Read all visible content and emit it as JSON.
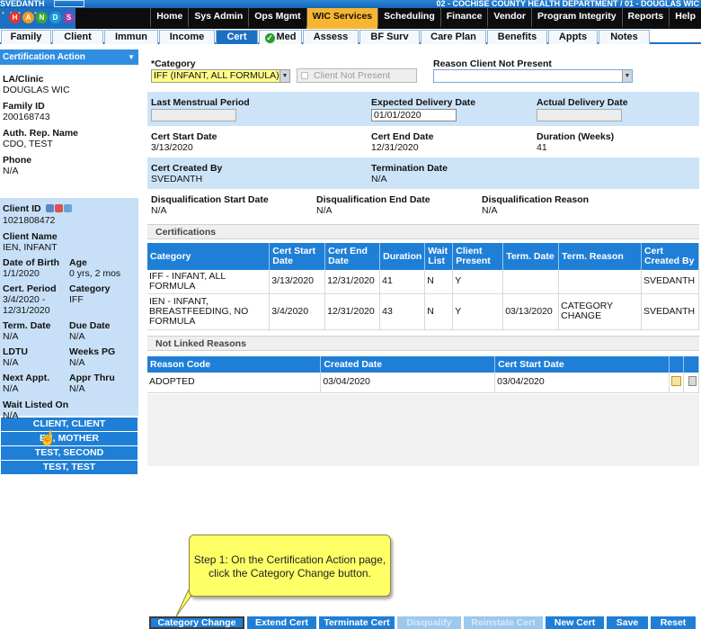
{
  "topbar": {
    "user": "SVEDANTH",
    "department": "02 - COCHISE COUNTY HEALTH DEPARTMENT / 01 - DOUGLAS WIC"
  },
  "logo": {
    "letters": [
      "H",
      "A",
      "N",
      "D",
      "S"
    ]
  },
  "main_nav": [
    {
      "label": "Home",
      "active": false
    },
    {
      "label": "Sys Admin",
      "active": false
    },
    {
      "label": "Ops Mgmt",
      "active": false
    },
    {
      "label": "WIC Services",
      "active": true
    },
    {
      "label": "Scheduling",
      "active": false
    },
    {
      "label": "Finance",
      "active": false
    },
    {
      "label": "Vendor",
      "active": false
    },
    {
      "label": "Program Integrity",
      "active": false
    },
    {
      "label": "Reports",
      "active": false
    },
    {
      "label": "Help",
      "active": false
    }
  ],
  "sub_tabs": [
    "Family",
    "Client",
    "Immun",
    "Income",
    "Cert",
    "Med",
    "Assess",
    "BF Surv",
    "Care Plan",
    "Benefits",
    "Appts",
    "Notes"
  ],
  "sub_tab_active": "Cert",
  "sidebar": {
    "header": "Certification Action",
    "la_clinic_label": "LA/Clinic",
    "la_clinic": "DOUGLAS WIC",
    "family_id_label": "Family ID",
    "family_id": "200168743",
    "auth_rep_label": "Auth. Rep. Name",
    "auth_rep": "CDO, TEST",
    "phone_label": "Phone",
    "phone": "N/A",
    "client_id_label": "Client ID",
    "client_id": "1021808472",
    "client_name_label": "Client Name",
    "client_name": "IEN, INFANT",
    "dob_label": "Date of Birth",
    "dob": "1/1/2020",
    "age_label": "Age",
    "age": "0 yrs, 2 mos",
    "cert_period_label": "Cert. Period",
    "cert_period_start": "3/4/2020 -",
    "cert_period_end": "12/31/2020",
    "category_label": "Category",
    "category": "IFF",
    "term_date_label": "Term. Date",
    "term_date": "N/A",
    "due_date_label": "Due Date",
    "due_date": "N/A",
    "ldtu_label": "LDTU",
    "ldtu": "N/A",
    "weeks_pg_label": "Weeks PG",
    "weeks_pg": "N/A",
    "next_appt_label": "Next Appt.",
    "next_appt": "N/A",
    "appr_thru_label": "Appr Thru",
    "appr_thru": "N/A",
    "wait_listed_label": "Wait Listed On",
    "wait_listed": "N/A",
    "family_members": [
      "CLIENT, CLIENT",
      "EN, MOTHER",
      "TEST, SECOND",
      "TEST, TEST"
    ]
  },
  "form": {
    "category_label": "*Category",
    "category_value": "IFF (INFANT, ALL FORMULA)",
    "client_not_present_label": "Client Not Present",
    "reason_label": "Reason Client Not Present",
    "reason_value": "",
    "lmp_label": "Last Menstrual Period",
    "lmp_value": "",
    "edd_label": "Expected Delivery Date",
    "edd_value": "01/01/2020",
    "add_label": "Actual Delivery Date",
    "add_value": "",
    "cert_start_label": "Cert Start Date",
    "cert_start": "3/13/2020",
    "cert_end_label": "Cert End Date",
    "cert_end": "12/31/2020",
    "duration_label": "Duration (Weeks)",
    "duration": "41",
    "created_by_label": "Cert Created By",
    "created_by": "SVEDANTH",
    "term_date_label": "Termination Date",
    "term_date": "N/A",
    "disq_start_label": "Disqualification Start Date",
    "disq_start": "N/A",
    "disq_end_label": "Disqualification End Date",
    "disq_end": "N/A",
    "disq_reason_label": "Disqualification Reason",
    "disq_reason": "N/A"
  },
  "certifications": {
    "title": "Certifications",
    "headers": [
      "Category",
      "Cert Start Date",
      "Cert End Date",
      "Duration",
      "Wait List",
      "Client Present",
      "Term. Date",
      "Term. Reason",
      "Cert Created By"
    ],
    "rows": [
      [
        "IFF - INFANT, ALL FORMULA",
        "3/13/2020",
        "12/31/2020",
        "41",
        "N",
        "Y",
        "",
        "",
        "SVEDANTH"
      ],
      [
        "IEN - INFANT, BREASTFEEDING, NO FORMULA",
        "3/4/2020",
        "12/31/2020",
        "43",
        "N",
        "Y",
        "03/13/2020",
        "CATEGORY CHANGE",
        "SVEDANTH"
      ]
    ]
  },
  "not_linked": {
    "title": "Not Linked Reasons",
    "headers": [
      "Reason Code",
      "Created Date",
      "Cert Start Date"
    ],
    "rows": [
      [
        "ADOPTED",
        "03/04/2020",
        "03/04/2020"
      ]
    ]
  },
  "callout": {
    "line1": "Step 1: On the Certification Action page,",
    "line2": "click the Category Change button."
  },
  "buttons": [
    {
      "label": "Category Change",
      "state": "selected"
    },
    {
      "label": "Extend Cert",
      "state": "enabled"
    },
    {
      "label": "Terminate Cert",
      "state": "enabled"
    },
    {
      "label": "Disqualify",
      "state": "disabled"
    },
    {
      "label": "Reinstate Cert",
      "state": "disabled"
    },
    {
      "label": "New Cert",
      "state": "enabled"
    },
    {
      "label": "Save",
      "state": "enabled"
    },
    {
      "label": "Reset",
      "state": "enabled"
    }
  ],
  "colors": {
    "primary_blue": "#1f7fd6",
    "nav_black": "#0d0d0d",
    "active_nav_orange": "#f7b531",
    "sidebar_blue": "#c8e0f7",
    "callout_yellow": "#ffff66"
  }
}
